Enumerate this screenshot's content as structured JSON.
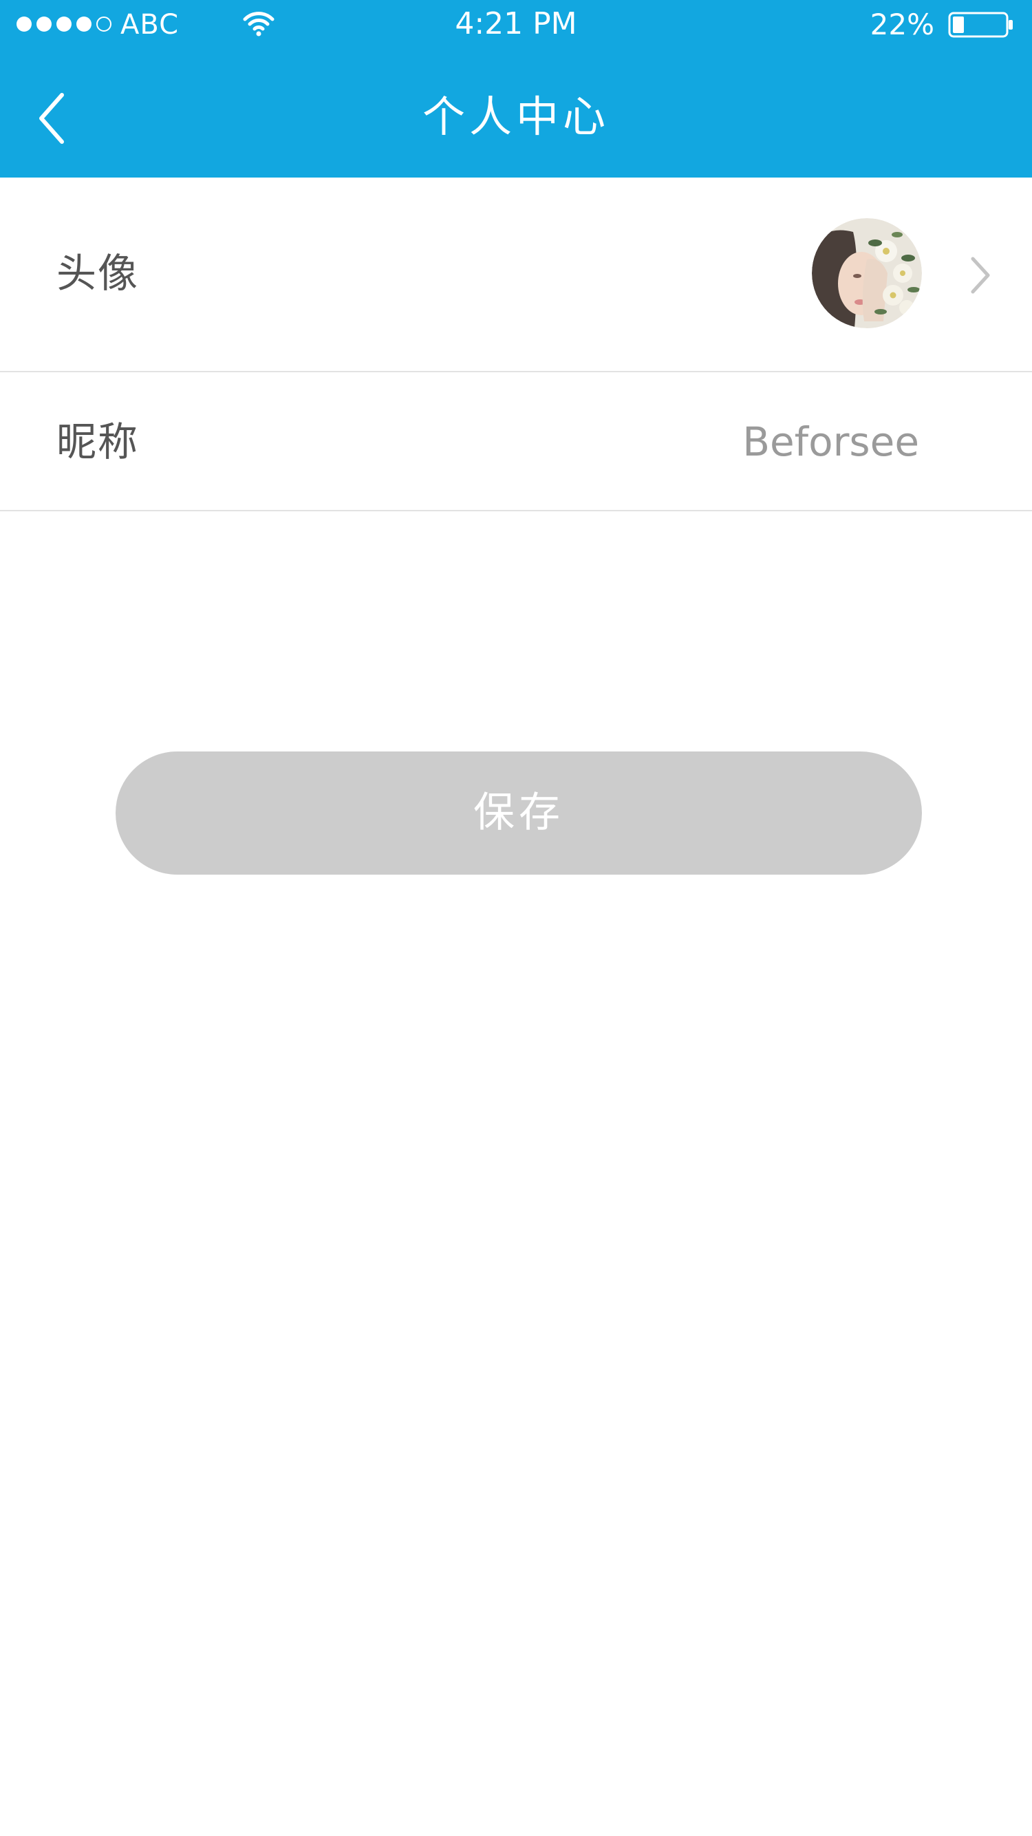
{
  "status_bar": {
    "carrier": "ABC",
    "time": "4:21 PM",
    "battery_percent": "22%",
    "signal_bars_filled": 4,
    "signal_bars_total": 5,
    "battery_level": 0.22
  },
  "nav": {
    "title": "个人中心",
    "back_icon": "chevron-left-icon"
  },
  "profile": {
    "avatar_label": "头像",
    "nickname_label": "昵称",
    "nickname_value": "Beforsee"
  },
  "actions": {
    "save_label": "保存"
  },
  "colors": {
    "header_bg": "#12a7e0",
    "button_bg": "#cccccc",
    "label_text": "#555555",
    "value_text": "#9a9a9a",
    "divider": "#e2e2e2"
  }
}
